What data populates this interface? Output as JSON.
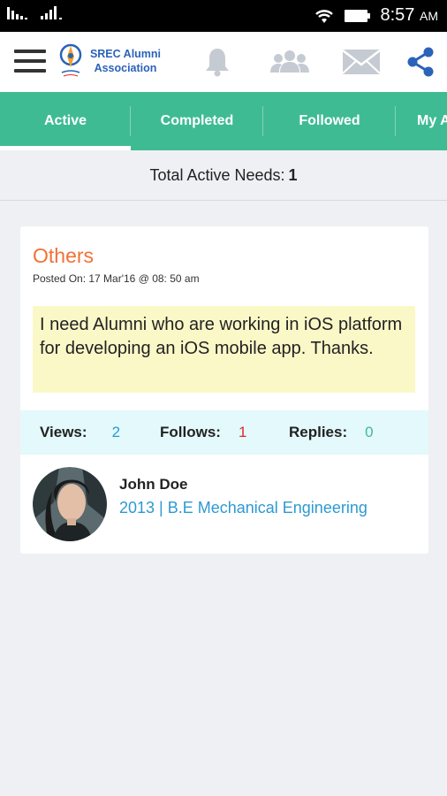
{
  "status_bar": {
    "time": "8:57",
    "ampm": "AM"
  },
  "app_bar": {
    "logo_text_line1": "SREC Alumni",
    "logo_text_line2": "Association",
    "icons": [
      "menu-icon",
      "bell-icon",
      "users-icon",
      "mail-icon",
      "share-icon"
    ],
    "brand_color": "#2a63b8"
  },
  "tabs": [
    {
      "label": "Active",
      "selected": true
    },
    {
      "label": "Completed",
      "selected": false
    },
    {
      "label": "Followed",
      "selected": false
    },
    {
      "label": "My A",
      "selected": false
    }
  ],
  "summary": {
    "label": "Total Active Needs:",
    "count": "1"
  },
  "need": {
    "category": "Others",
    "posted_on": "Posted On: 17 Mar'16 @ 08: 50 am",
    "message": "I need Alumni who are working in iOS platform for developing an iOS mobile app. Thanks.",
    "stats": {
      "views_label": "Views:",
      "views": "2",
      "follows_label": "Follows:",
      "follows": "1",
      "replies_label": "Replies:",
      "replies": "0"
    },
    "author": {
      "name": "John Doe",
      "info": "2013 | B.E Mechanical Engineering"
    }
  },
  "colors": {
    "tab_bar": "#3fbb94",
    "category": "#f07236",
    "views": "#2d9ad1",
    "follows": "#e02a2a",
    "replies": "#3fbb94",
    "message_bg": "#fbf8c8",
    "stats_bg": "#e3f9fb"
  }
}
